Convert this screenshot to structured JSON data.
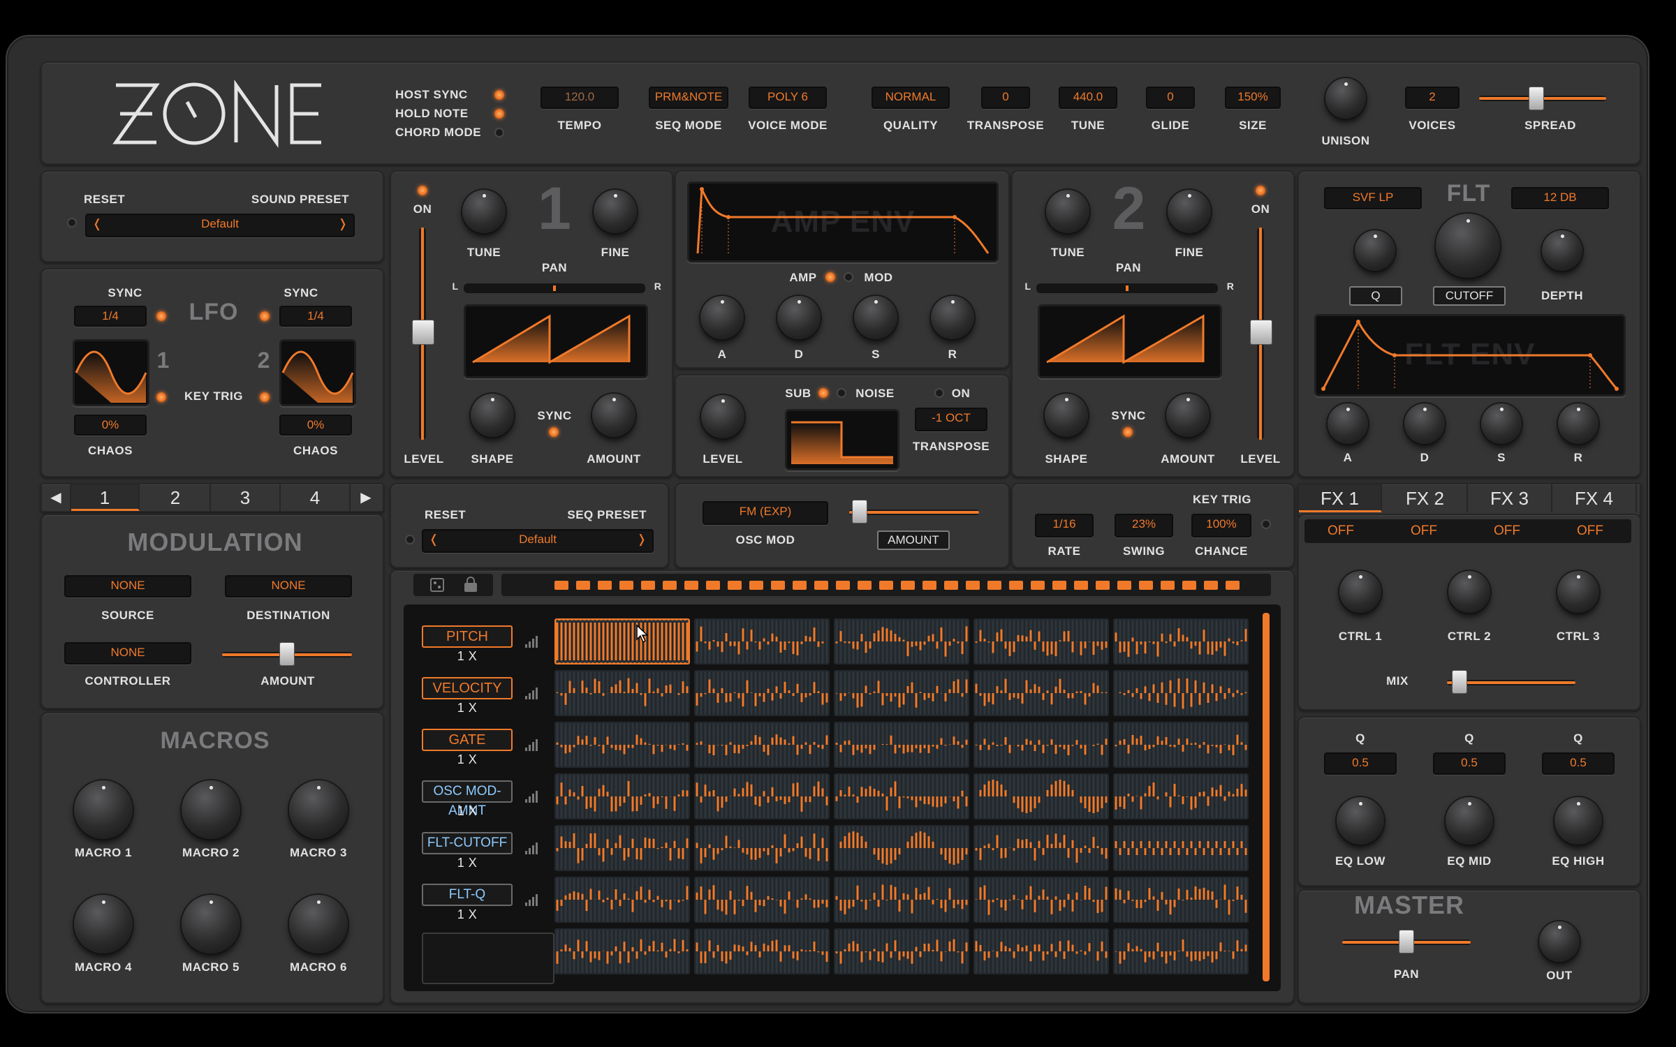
{
  "header": {
    "logo": "ZONE",
    "toggles": [
      {
        "label": "HOST SYNC",
        "on": true
      },
      {
        "label": "HOLD NOTE",
        "on": true
      },
      {
        "label": "CHORD MODE",
        "on": false
      }
    ],
    "fields": [
      {
        "label": "TEMPO",
        "value": "120.0",
        "dim": true
      },
      {
        "label": "SEQ MODE",
        "value": "PRM&NOTE"
      },
      {
        "label": "VOICE MODE",
        "value": "POLY 6"
      },
      {
        "label": "QUALITY",
        "value": "NORMAL"
      },
      {
        "label": "TRANSPOSE",
        "value": "0"
      },
      {
        "label": "TUNE",
        "value": "440.0"
      },
      {
        "label": "GLIDE",
        "value": "0"
      },
      {
        "label": "SIZE",
        "value": "150%"
      }
    ],
    "unison_label": "UNISON",
    "voices": {
      "label": "VOICES",
      "value": "2"
    },
    "spread": {
      "label": "SPREAD",
      "level": 0.45
    }
  },
  "preset": {
    "reset": "RESET",
    "title": "SOUND PRESET",
    "value": "Default",
    "prev": "❬",
    "next": "❭"
  },
  "lfo": {
    "title": "LFO",
    "sync": "SYNC",
    "key_trig": "KEY TRIG",
    "chaos": "CHAOS",
    "lfo1": {
      "num": "1",
      "rate": "1/4",
      "chaos": "0%"
    },
    "lfo2": {
      "num": "2",
      "rate": "1/4",
      "chaos": "0%"
    }
  },
  "mod_tabs": {
    "prev": "◀",
    "next": "▶",
    "tabs": [
      "1",
      "2",
      "3",
      "4"
    ],
    "active": 0
  },
  "modulation": {
    "title": "MODULATION",
    "source": {
      "label": "SOURCE",
      "value": "NONE"
    },
    "destination": {
      "label": "DESTINATION",
      "value": "NONE"
    },
    "controller": {
      "label": "CONTROLLER",
      "value": "NONE"
    },
    "amount_label": "AMOUNT",
    "amount_level": 0.5
  },
  "macros": {
    "title": "MACROS",
    "items": [
      "MACRO 1",
      "MACRO 2",
      "MACRO 3",
      "MACRO 4",
      "MACRO 5",
      "MACRO 6"
    ]
  },
  "osc1": {
    "num": "1",
    "on": "ON",
    "tune": "TUNE",
    "fine": "FINE",
    "pan": "PAN",
    "l": "L",
    "r": "R",
    "shape": "SHAPE",
    "sync": "SYNC",
    "amount": "AMOUNT",
    "level": "LEVEL"
  },
  "osc2": {
    "num": "2",
    "on": "ON",
    "tune": "TUNE",
    "fine": "FINE",
    "pan": "PAN",
    "l": "L",
    "r": "R",
    "shape": "SHAPE",
    "sync": "SYNC",
    "amount": "AMOUNT",
    "level": "LEVEL"
  },
  "amp_env": {
    "title": "AMP ENV",
    "amp": "AMP",
    "mod": "MOD",
    "knobs": [
      "A",
      "D",
      "S",
      "R"
    ]
  },
  "sub": {
    "level": "LEVEL",
    "sub": "SUB",
    "noise": "NOISE",
    "on": "ON",
    "transpose_value": "-1 OCT",
    "transpose": "TRANSPOSE"
  },
  "filter": {
    "type": "SVF LP",
    "title": "FLT",
    "slope": "12 DB",
    "q": "Q",
    "cutoff": "CUTOFF",
    "depth": "DEPTH",
    "env_title": "FLT ENV",
    "knobs": [
      "A",
      "D",
      "S",
      "R"
    ]
  },
  "seq_preset": {
    "reset": "RESET",
    "title": "SEQ PRESET",
    "value": "Default",
    "prev": "❬",
    "next": "❭"
  },
  "osc_mod": {
    "value": "FM (EXP)",
    "label": "OSC MOD",
    "amount": "AMOUNT",
    "level": 0.08
  },
  "seq_params": {
    "rate": {
      "label": "RATE",
      "value": "1/16"
    },
    "swing": {
      "label": "SWING",
      "value": "23%"
    },
    "chance": {
      "label": "CHANCE",
      "value": "100%"
    },
    "key_trig": "KEY TRIG"
  },
  "seq_rows": [
    {
      "name": "PITCH",
      "mult": "1 X",
      "color": "orange"
    },
    {
      "name": "VELOCITY",
      "mult": "1 X",
      "color": "orange"
    },
    {
      "name": "GATE",
      "mult": "1 X",
      "color": "orange"
    },
    {
      "name": "OSC MOD-AMNT",
      "mult": "1 X",
      "color": "blue"
    },
    {
      "name": "FLT-CUTOFF",
      "mult": "1 X",
      "color": "blue"
    },
    {
      "name": "FLT-Q",
      "mult": "1 X",
      "color": "blue"
    }
  ],
  "fx": {
    "tabs": [
      "FX 1",
      "FX 2",
      "FX 3",
      "FX 4"
    ],
    "states": [
      "OFF",
      "OFF",
      "OFF",
      "OFF"
    ],
    "ctrls": [
      "CTRL 1",
      "CTRL 2",
      "CTRL 3"
    ],
    "mix": "MIX",
    "mix_level": 0.1
  },
  "eq": {
    "q": "Q",
    "values": [
      "0.5",
      "0.5",
      "0.5"
    ],
    "bands": [
      "EQ LOW",
      "EQ MID",
      "EQ HIGH"
    ]
  },
  "master": {
    "title": "MASTER",
    "pan": "PAN",
    "out": "OUT",
    "pan_level": 0.5
  },
  "colors": {
    "accent": "#f07a2a",
    "panel": "#353536",
    "blue_text": "#8ecbff"
  }
}
